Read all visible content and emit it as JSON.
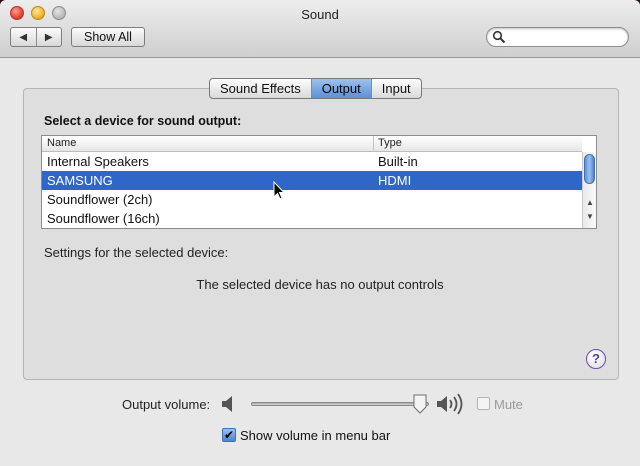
{
  "window": {
    "title": "Sound"
  },
  "toolbar": {
    "back_label": "◀",
    "forward_label": "▶",
    "show_all_label": "Show All",
    "search_placeholder": ""
  },
  "tabs": [
    {
      "label": "Sound Effects",
      "active": false
    },
    {
      "label": "Output",
      "active": true
    },
    {
      "label": "Input",
      "active": false
    }
  ],
  "output": {
    "select_label": "Select a device for sound output:",
    "columns": [
      "Name",
      "Type"
    ],
    "devices": [
      {
        "name": "Internal Speakers",
        "type": "Built-in",
        "selected": false
      },
      {
        "name": "SAMSUNG",
        "type": "HDMI",
        "selected": true
      },
      {
        "name": "Soundflower (2ch)",
        "type": "",
        "selected": false
      },
      {
        "name": "Soundflower (16ch)",
        "type": "",
        "selected": false
      }
    ],
    "settings_label": "Settings for the selected device:",
    "no_controls_text": "The selected device has no output controls"
  },
  "help_label": "?",
  "volume": {
    "label": "Output volume:",
    "level": 0.95,
    "mute_label": "Mute",
    "mute_checked": false
  },
  "menu_bar": {
    "label": "Show volume in menu bar",
    "checked": true,
    "check_glyph": "✔"
  },
  "colors": {
    "selection": "#2f67c9",
    "tab_active": "#5b8fd6"
  }
}
